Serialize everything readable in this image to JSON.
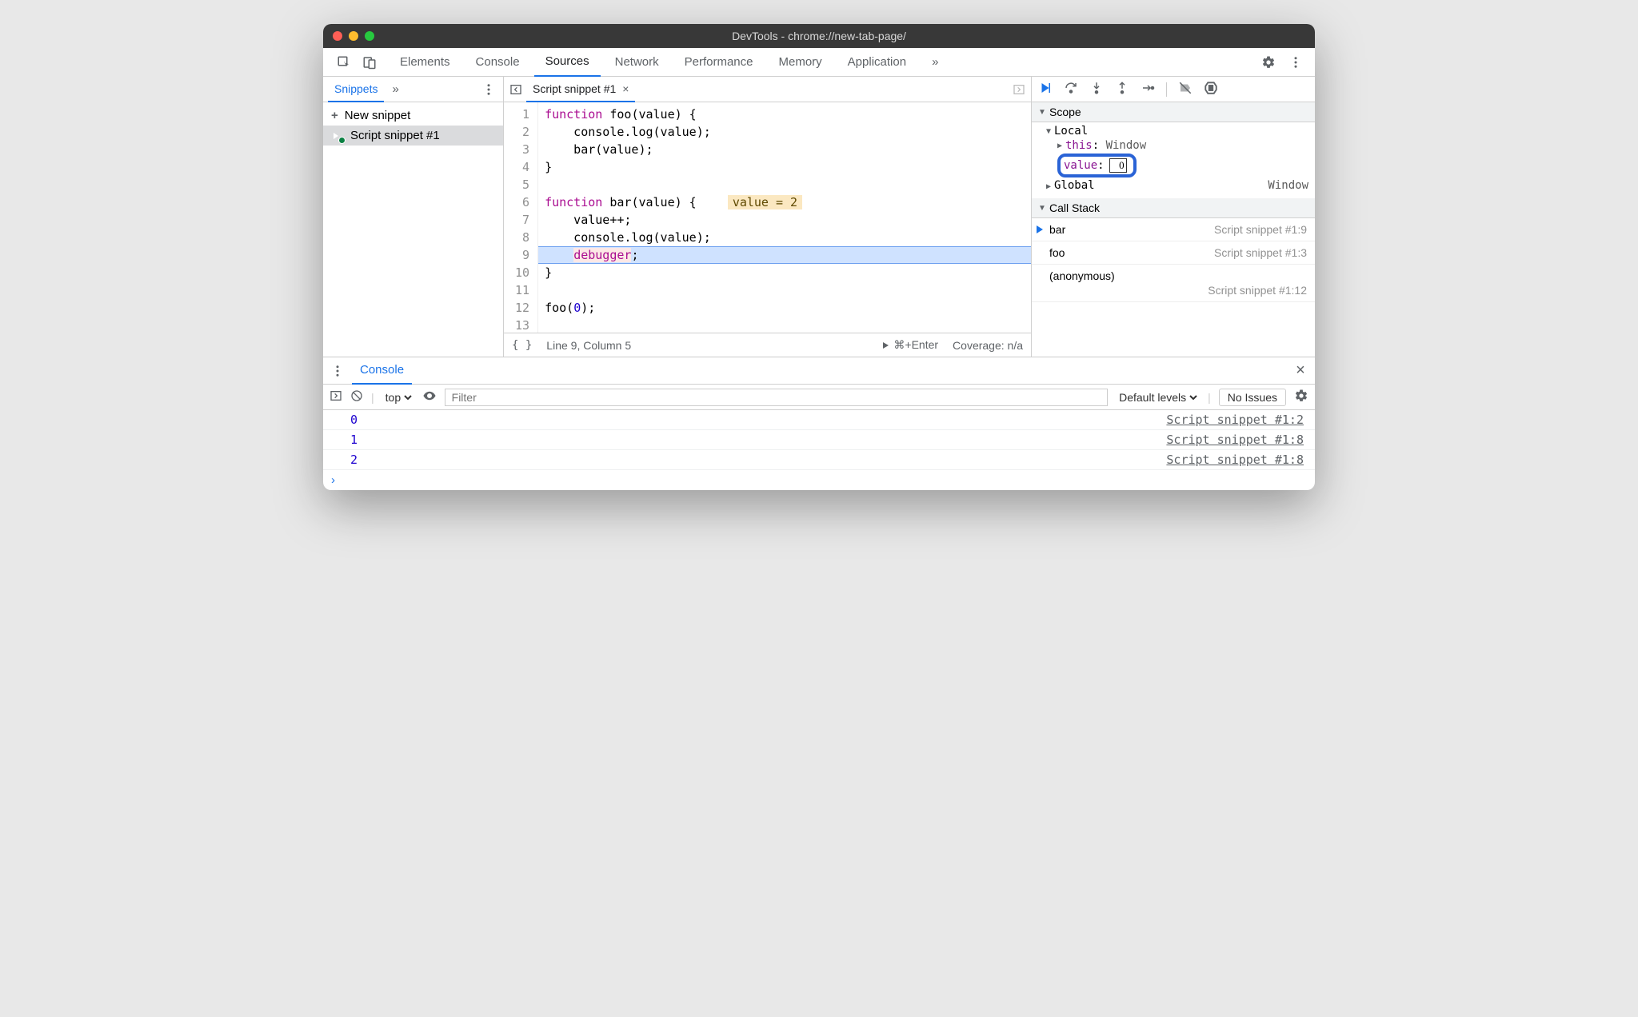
{
  "window": {
    "title": "DevTools - chrome://new-tab-page/"
  },
  "mainTabs": {
    "elements": "Elements",
    "console": "Console",
    "sources": "Sources",
    "network": "Network",
    "performance": "Performance",
    "memory": "Memory",
    "application": "Application",
    "more": "»"
  },
  "sidebar": {
    "tab": "Snippets",
    "more": "»",
    "newSnippet": "New snippet",
    "items": [
      {
        "label": "Script snippet #1"
      }
    ]
  },
  "editor": {
    "tabLabel": "Script snippet #1",
    "lines": [
      {
        "n": 1,
        "html": "<span class='kw'>function</span> <span class='fn'>foo</span>(value) {"
      },
      {
        "n": 2,
        "html": "    console.log(value);"
      },
      {
        "n": 3,
        "html": "    bar(value);"
      },
      {
        "n": 4,
        "html": "}"
      },
      {
        "n": 5,
        "html": ""
      },
      {
        "n": 6,
        "html": "<span class='kw'>function</span> <span class='fn'>bar</span>(value) {   <span class='inline-val'>value = 2</span>"
      },
      {
        "n": 7,
        "html": "    value++;"
      },
      {
        "n": 8,
        "html": "    console.log(value);"
      },
      {
        "n": 9,
        "html": "    <span class='dbg'>debugger</span>;",
        "exec": true
      },
      {
        "n": 10,
        "html": "}"
      },
      {
        "n": 11,
        "html": ""
      },
      {
        "n": 12,
        "html": "foo(<span class='num'>0</span>);"
      },
      {
        "n": 13,
        "html": ""
      }
    ],
    "status": {
      "braces": "{ }",
      "pos": "Line 9, Column 5",
      "runHint": "⌘+Enter",
      "coverage": "Coverage: n/a"
    }
  },
  "debug": {
    "scopeLabel": "Scope",
    "localLabel": "Local",
    "thisName": "this",
    "thisVal": "Window",
    "valueName": "value",
    "valueEditing": "0",
    "globalLabel": "Global",
    "globalVal": "Window",
    "callStackLabel": "Call Stack",
    "stack": [
      {
        "fn": "bar",
        "loc": "Script snippet #1:9",
        "active": true
      },
      {
        "fn": "foo",
        "loc": "Script snippet #1:3"
      }
    ],
    "anonLabel": "(anonymous)",
    "anonLoc": "Script snippet #1:12"
  },
  "drawer": {
    "tab": "Console",
    "context": "top",
    "filterPlaceholder": "Filter",
    "levels": "Default levels",
    "noIssues": "No Issues",
    "logs": [
      {
        "val": "0",
        "src": "Script snippet #1:2"
      },
      {
        "val": "1",
        "src": "Script snippet #1:8"
      },
      {
        "val": "2",
        "src": "Script snippet #1:8"
      }
    ]
  }
}
